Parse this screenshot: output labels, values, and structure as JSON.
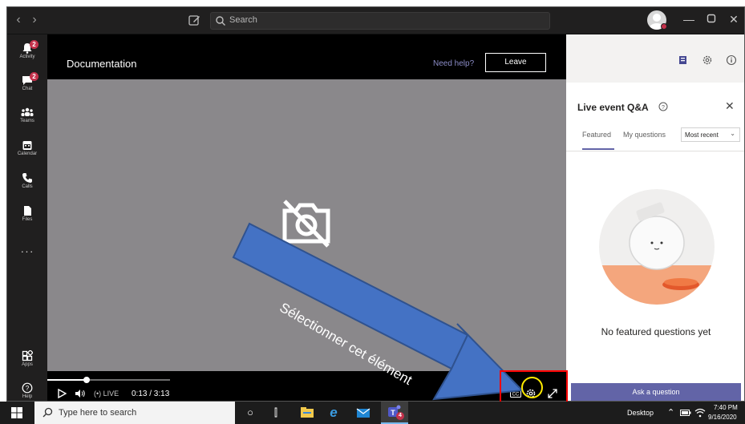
{
  "titlebar": {
    "search_placeholder": "Search",
    "icons": [
      "back-arrow-icon",
      "forward-arrow-icon",
      "compose-icon",
      "search-icon",
      "avatar",
      "minimize-icon",
      "maximize-icon",
      "close-icon"
    ]
  },
  "app_rail": {
    "items": [
      {
        "label": "Activity",
        "icon": "bell-icon",
        "badge": "2"
      },
      {
        "label": "Chat",
        "icon": "chat-icon",
        "badge": "2"
      },
      {
        "label": "Teams",
        "icon": "teams-icon"
      },
      {
        "label": "Calendar",
        "icon": "calendar-icon"
      },
      {
        "label": "Calls",
        "icon": "phone-icon"
      },
      {
        "label": "Files",
        "icon": "file-icon"
      },
      {
        "label": "Apps",
        "icon": "apps-icon"
      },
      {
        "label": "Help",
        "icon": "help-icon"
      }
    ],
    "more": "···"
  },
  "meeting": {
    "title": "Documentation",
    "need_help": "Need help?",
    "leave_label": "Leave",
    "player": {
      "live_label": "LIVE",
      "time": "0:13 / 3:13",
      "progress": 0.32
    }
  },
  "qa_panel": {
    "title": "Live event Q&A",
    "tabs": [
      "Featured",
      "My questions"
    ],
    "active_tab": "Featured",
    "sort_selected": "Most recent",
    "empty_state": "No featured questions yet",
    "ask_button": "Ask a question"
  },
  "annotation": {
    "text": "Sélectionner cet élément",
    "arrow_color": "#4472c4",
    "box_color": "#ff0000",
    "circle_color": "#ffeb00"
  },
  "taskbar": {
    "search_placeholder": "Type here to search",
    "desktop_label": "Desktop",
    "teams_badge": "4",
    "time": "7:40 PM",
    "date": "9/16/2020"
  },
  "colors": {
    "teams_purple": "#6264a7",
    "badge_red": "#c4314b"
  }
}
